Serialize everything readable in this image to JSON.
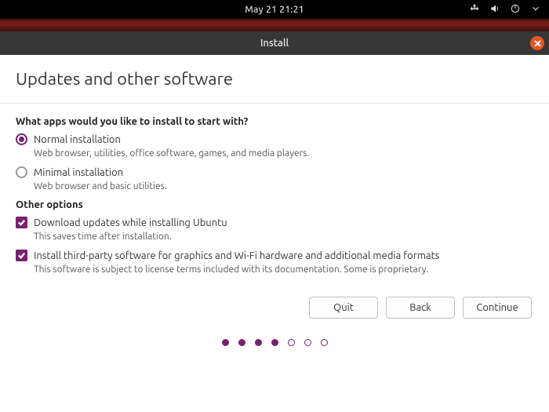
{
  "topbar": {
    "datetime": "May 21  21:21"
  },
  "titlebar": {
    "title": "Install"
  },
  "page": {
    "heading": "Updates and other software",
    "question": "What apps would you like to install to start with?",
    "other_options_label": "Other options"
  },
  "install_type": {
    "normal": {
      "label": "Normal installation",
      "desc": "Web browser, utilities, office software, games, and media players."
    },
    "minimal": {
      "label": "Minimal installation",
      "desc": "Web browser and basic utilities."
    }
  },
  "options": {
    "download_updates": {
      "label": "Download updates while installing Ubuntu",
      "desc": "This saves time after installation."
    },
    "third_party": {
      "label": "Install third-party software for graphics and Wi-Fi hardware and additional media formats",
      "desc": "This software is subject to license terms included with its documentation. Some is proprietary."
    }
  },
  "buttons": {
    "quit": "Quit",
    "back": "Back",
    "continue": "Continue"
  }
}
